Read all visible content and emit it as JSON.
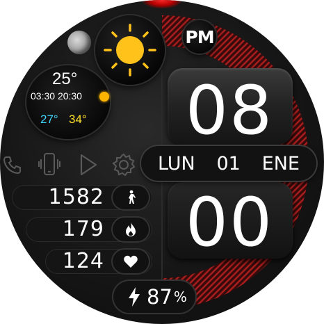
{
  "watch_face": {
    "ampm": "PM",
    "weather": {
      "icon": "sun-icon",
      "temperature": "25°",
      "sunrise": "03:30",
      "sunset": "20:30",
      "temp_min": "27°",
      "temp_max": "34°"
    },
    "time": {
      "hours": "08",
      "minutes": "00"
    },
    "date": {
      "weekday": "LUN",
      "day": "01",
      "month": "ENE"
    },
    "shortcuts": [
      "phone-icon",
      "vibrate-icon",
      "play-icon",
      "gear-icon"
    ],
    "stats": {
      "steps": "1582",
      "calories": "179",
      "heart_rate": "124"
    },
    "battery": {
      "value": "87",
      "unit": "%"
    },
    "colors": {
      "accent_red": "#c41a1a",
      "sun_yellow": "#ffc21a",
      "temp_min_color": "#3fd8ff",
      "temp_max_color": "#ffe02a"
    }
  }
}
